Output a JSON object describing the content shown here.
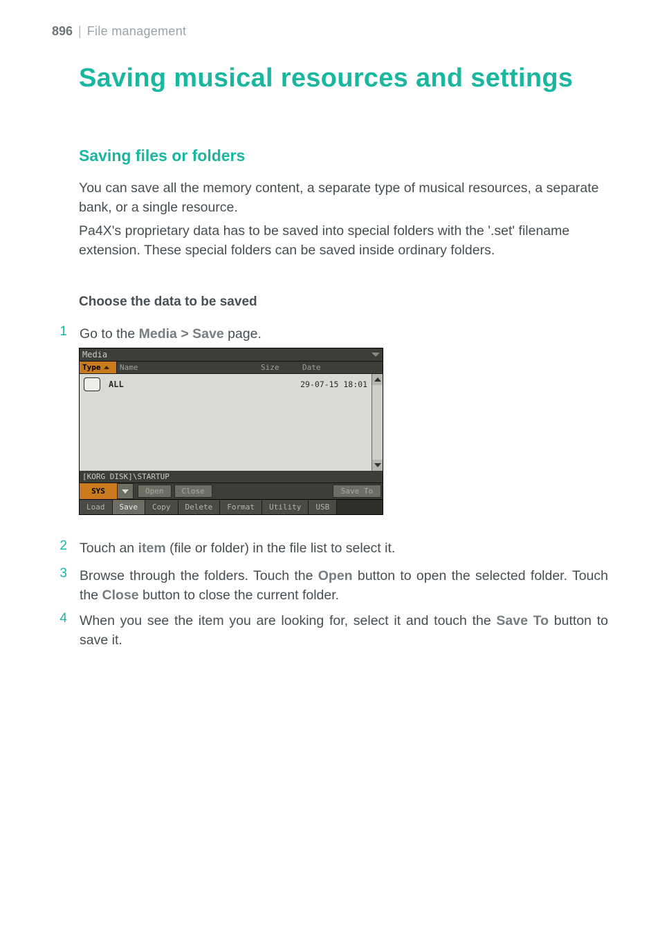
{
  "header": {
    "page_number": "896",
    "pipe": "|",
    "section": "File management"
  },
  "title": "Saving musical resources and settings",
  "section_heading": "Saving files or folders",
  "paragraphs": {
    "p1": "You can save all the memory content, a separate type of musical resources, a separate bank, or a single resource.",
    "p2": "Pa4X's proprietary data has to be saved into special folders with the '.set' filename extension. These special folders can be saved inside ordinary folders."
  },
  "subhead": "Choose the data to be saved",
  "steps": {
    "s1": {
      "num": "1",
      "pre": "Go to the ",
      "hl1": "Media > Save",
      "post": " page."
    },
    "s2": {
      "num": "2",
      "pre": "Touch an ",
      "hl1": "item",
      "post": " (file or folder) in the file list to select it."
    },
    "s3": {
      "num": "3",
      "a": "Browse through the folders. Touch the ",
      "hl1": "Open",
      "b": " button to open the selected folder. Touch the ",
      "hl2": "Close",
      "c": " button to close the current folder."
    },
    "s4": {
      "num": "4",
      "a": "When you see the item you are looking for, select it and touch the ",
      "hl1": "Save To",
      "b": " button to save it."
    }
  },
  "screenshot": {
    "window_title": "Media",
    "columns": {
      "type": "Type",
      "name": "Name",
      "size": "Size",
      "date": "Date"
    },
    "rows": [
      {
        "name": "ALL",
        "size": "",
        "date": "29-07-15 18:01"
      }
    ],
    "path": "[KORG DISK]\\STARTUP",
    "drive": "SYS",
    "buttons": {
      "open": "Open",
      "close": "Close",
      "save_to": "Save To"
    },
    "tabs": [
      "Load",
      "Save",
      "Copy",
      "Delete",
      "Format",
      "Utility",
      "USB"
    ],
    "active_tab": "Save"
  }
}
